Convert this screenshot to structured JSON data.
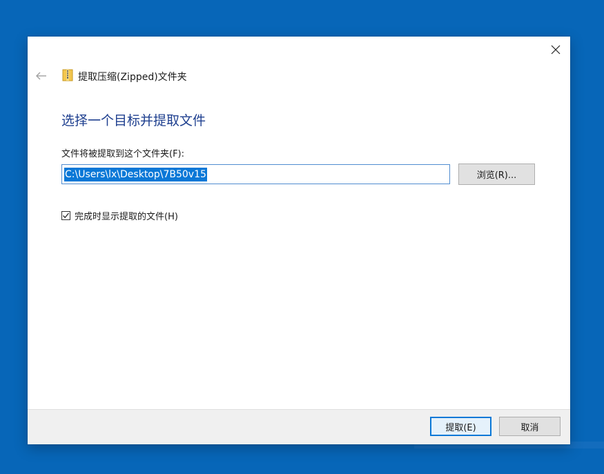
{
  "wizard": {
    "title": "提取压缩(Zipped)文件夹",
    "heading": "选择一个目标并提取文件",
    "field_label": "文件将被提取到这个文件夹(F):",
    "path_value": "C:\\Users\\lx\\Desktop\\7B50v15",
    "browse_label": "浏览(R)...",
    "show_files_label": "完成时显示提取的文件(H)",
    "show_files_checked": true
  },
  "footer": {
    "extract_label": "提取(E)",
    "cancel_label": "取消"
  },
  "icons": {
    "close": "close-icon",
    "back": "back-arrow-icon",
    "folder": "zip-folder-icon",
    "check": "checkmark-icon"
  },
  "colors": {
    "desktop": "#0766b8",
    "accent": "#0a78d7",
    "heading": "#1e3f8f"
  }
}
